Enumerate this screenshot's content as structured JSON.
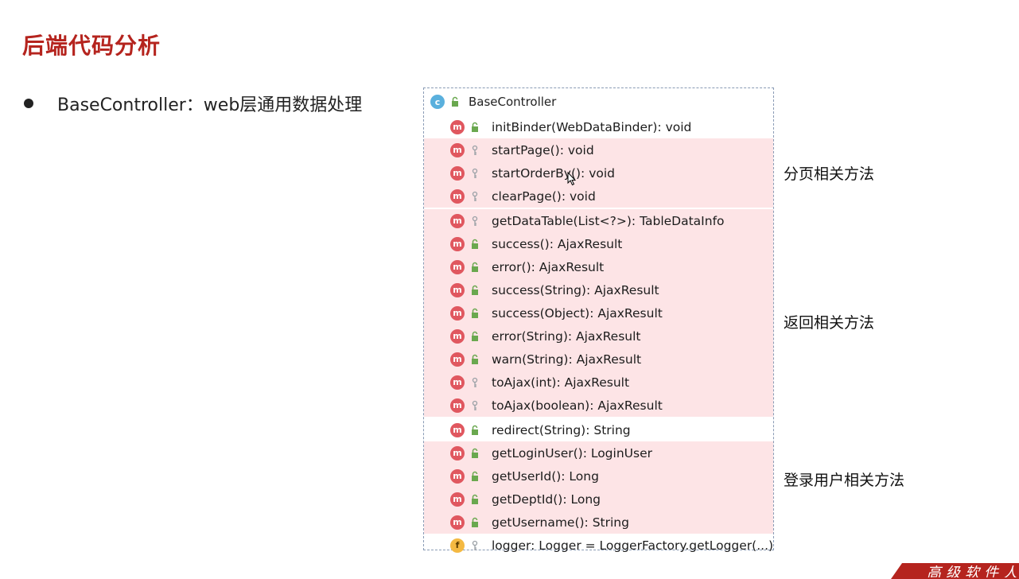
{
  "slide": {
    "title": "后端代码分析",
    "bullet": "BaseController：web层通用数据处理",
    "footer_text": "高级软件人"
  },
  "diagram": {
    "class_name": "BaseController",
    "class_badge": "c",
    "members": [
      {
        "badge": "m",
        "visibility": "public",
        "text": "initBinder(WebDataBinder): void",
        "highlight": false
      },
      {
        "badge": "m",
        "visibility": "protected",
        "text": "startPage(): void",
        "highlight": true
      },
      {
        "badge": "m",
        "visibility": "protected",
        "text": "startOrderBy(): void",
        "highlight": true
      },
      {
        "badge": "m",
        "visibility": "protected",
        "text": "clearPage(): void",
        "highlight": true
      },
      {
        "badge": "m",
        "visibility": "protected",
        "text": "getDataTable(List<?>): TableDataInfo",
        "highlight": true
      },
      {
        "badge": "m",
        "visibility": "public",
        "text": "success(): AjaxResult",
        "highlight": true
      },
      {
        "badge": "m",
        "visibility": "public",
        "text": "error(): AjaxResult",
        "highlight": true
      },
      {
        "badge": "m",
        "visibility": "public",
        "text": "success(String): AjaxResult",
        "highlight": true
      },
      {
        "badge": "m",
        "visibility": "public",
        "text": "success(Object): AjaxResult",
        "highlight": true
      },
      {
        "badge": "m",
        "visibility": "public",
        "text": "error(String): AjaxResult",
        "highlight": true
      },
      {
        "badge": "m",
        "visibility": "public",
        "text": "warn(String): AjaxResult",
        "highlight": true
      },
      {
        "badge": "m",
        "visibility": "protected",
        "text": "toAjax(int): AjaxResult",
        "highlight": true
      },
      {
        "badge": "m",
        "visibility": "protected",
        "text": "toAjax(boolean): AjaxResult",
        "highlight": true
      },
      {
        "badge": "m",
        "visibility": "public",
        "text": "redirect(String): String",
        "highlight": false
      },
      {
        "badge": "m",
        "visibility": "public",
        "text": "getLoginUser(): LoginUser",
        "highlight": true
      },
      {
        "badge": "m",
        "visibility": "public",
        "text": "getUserId(): Long",
        "highlight": true
      },
      {
        "badge": "m",
        "visibility": "public",
        "text": "getDeptId(): Long",
        "highlight": true
      },
      {
        "badge": "m",
        "visibility": "public",
        "text": "getUsername(): String",
        "highlight": true
      },
      {
        "badge": "f",
        "visibility": "protected",
        "text": "logger: Logger = LoggerFactory.getLogger(...)",
        "highlight": false
      }
    ]
  },
  "annotations": {
    "paging": "分页相关方法",
    "result": "返回相关方法",
    "login_user": "登录用户相关方法"
  },
  "colors": {
    "title": "#b5241e",
    "highlight": "#fde4e6",
    "method_badge": "#e0575f",
    "class_badge": "#5ab0dd",
    "field_badge": "#f4b942",
    "public_lock": "#6aa84f",
    "protected_key": "#9aa0a6"
  }
}
